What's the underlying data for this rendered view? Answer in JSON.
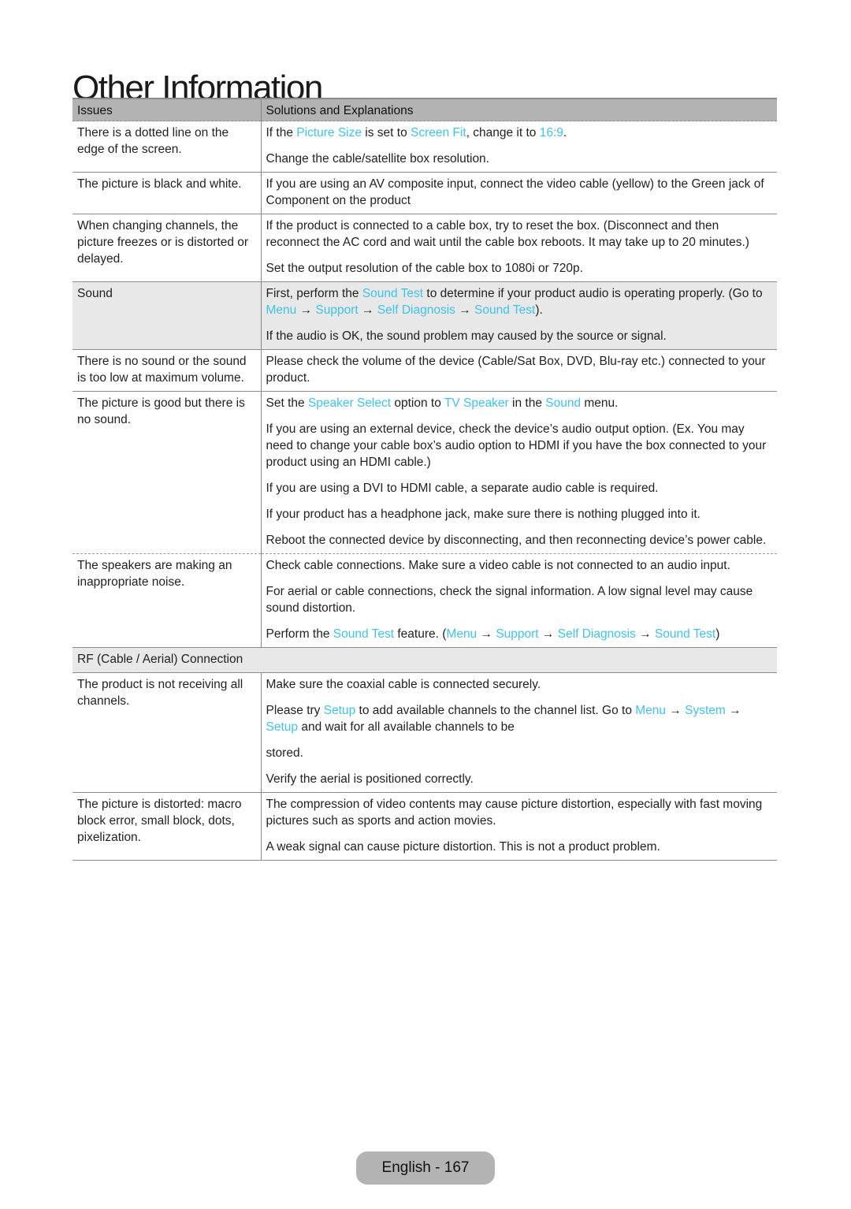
{
  "page": {
    "title": "Other Information",
    "footer": "English - 167"
  },
  "colors": {
    "highlight": "#3ec3ee",
    "header_bg": "#b3b3b3",
    "section_bg": "#e8e8e8"
  },
  "table": {
    "headers": [
      "Issues",
      "Solutions and Explanations"
    ],
    "rows": [
      {
        "issue": "There is a dotted line on the edge of the screen.",
        "solutions": [
          [
            {
              "t": "If the "
            },
            {
              "t": "Picture Size",
              "hl": true
            },
            {
              "t": " is set to "
            },
            {
              "t": "Screen Fit",
              "hl": true
            },
            {
              "t": ", change it to "
            },
            {
              "t": "16:9",
              "hl": true
            },
            {
              "t": "."
            }
          ],
          [
            {
              "t": "Change the cable/satellite box resolution."
            }
          ]
        ]
      },
      {
        "issue": "The picture is black and white.",
        "solutions": [
          [
            {
              "t": "If you are using an AV composite input, connect the video cable (yellow) to the Green jack of Component on the product"
            }
          ]
        ]
      },
      {
        "issue": "When changing channels, the picture freezes or is distorted or delayed.",
        "solutions": [
          [
            {
              "t": "If the product is connected to a cable box, try to reset the box. (Disconnect and then reconnect the AC cord and wait until the cable box reboots. It may take up to 20 minutes.)"
            }
          ],
          [
            {
              "t": "Set the output resolution of the cable box to 1080i or 720p."
            }
          ]
        ]
      },
      {
        "issue": "Sound",
        "shaded": true,
        "solutions": [
          [
            {
              "t": "First, perform the "
            },
            {
              "t": "Sound Test",
              "hl": true
            },
            {
              "t": " to determine if your product audio is operating properly. (Go to "
            },
            {
              "t": "Menu",
              "hl": true
            },
            {
              "t": " → "
            },
            {
              "t": "Support",
              "hl": true
            },
            {
              "t": " → "
            },
            {
              "t": "Self Diagnosis",
              "hl": true
            },
            {
              "t": " → "
            },
            {
              "t": "Sound Test",
              "hl": true
            },
            {
              "t": ")."
            }
          ],
          [
            {
              "t": "If the audio is OK, the sound problem may caused by the source or signal."
            }
          ]
        ]
      },
      {
        "issue": "There is no sound or the sound is too low at maximum volume.",
        "solutions": [
          [
            {
              "t": "Please check the volume of the device (Cable/Sat Box, DVD, Blu-ray etc.) connected to your product."
            }
          ]
        ]
      },
      {
        "issue": "The picture is good but there is no sound.",
        "dashed": true,
        "solutions": [
          [
            {
              "t": "Set the "
            },
            {
              "t": "Speaker Select",
              "hl": true
            },
            {
              "t": " option to "
            },
            {
              "t": "TV Speaker",
              "hl": true
            },
            {
              "t": " in the "
            },
            {
              "t": "Sound",
              "hl": true
            },
            {
              "t": " menu."
            }
          ],
          [
            {
              "t": "If you are using an external device, check the device’s audio output option. (Ex. You may need to change your cable box’s audio option to HDMI if you have the box connected to your product using an HDMI cable.)"
            }
          ],
          [
            {
              "t": "If you are using a DVI to HDMI cable, a separate audio cable is required."
            }
          ],
          [
            {
              "t": "If your product has a headphone jack, make sure there is nothing plugged into it."
            }
          ],
          [
            {
              "t": "Reboot the connected device by disconnecting, and then reconnecting device’s power cable."
            }
          ]
        ]
      },
      {
        "issue": "The speakers are making an inappropriate noise.",
        "solutions": [
          [
            {
              "t": "Check cable connections. Make sure a video cable is not connected to an audio input."
            }
          ],
          [
            {
              "t": "For aerial or cable connections, check the signal information. A low signal level may cause sound distortion."
            }
          ],
          [
            {
              "t": "Perform the "
            },
            {
              "t": "Sound Test",
              "hl": true
            },
            {
              "t": " feature. ("
            },
            {
              "t": "Menu",
              "hl": true
            },
            {
              "t": " → "
            },
            {
              "t": "Support",
              "hl": true
            },
            {
              "t": " → "
            },
            {
              "t": "Self Diagnosis",
              "hl": true
            },
            {
              "t": " → "
            },
            {
              "t": "Sound Test",
              "hl": true
            },
            {
              "t": ")"
            }
          ]
        ]
      },
      {
        "section": "RF (Cable / Aerial) Connection"
      },
      {
        "issue": "The product is not receiving all channels.",
        "solutions": [
          [
            {
              "t": "Make sure the coaxial cable is connected securely."
            }
          ],
          [
            {
              "t": "Please try "
            },
            {
              "t": "Setup",
              "hl": true
            },
            {
              "t": " to add available channels to the channel list. Go to "
            },
            {
              "t": "Menu",
              "hl": true
            },
            {
              "t": " → "
            },
            {
              "t": "System",
              "hl": true
            },
            {
              "t": " → "
            },
            {
              "t": "Setup",
              "hl": true
            },
            {
              "t": " and wait for all available channels to be"
            }
          ],
          [
            {
              "t": "stored."
            }
          ],
          [
            {
              "t": "Verify the aerial is positioned correctly."
            }
          ]
        ]
      },
      {
        "issue": "The picture is distorted: macro block error, small block, dots, pixelization.",
        "solutions": [
          [
            {
              "t": "The compression of video contents may cause picture distortion, especially with fast moving pictures such as sports and action movies."
            }
          ],
          [
            {
              "t": "A weak signal can cause picture distortion. This is not a product problem."
            }
          ]
        ]
      }
    ]
  }
}
